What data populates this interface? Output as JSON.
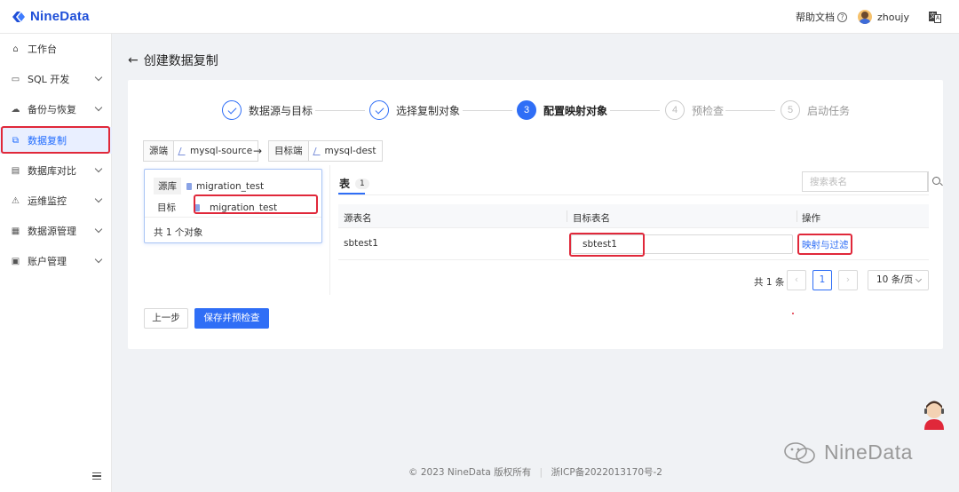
{
  "header": {
    "brand": "NineData",
    "help_label": "帮助文档",
    "user_name": "zhoujy"
  },
  "sidebar": {
    "items": [
      {
        "label": "工作台",
        "icon": "home-icon",
        "has_arrow": false
      },
      {
        "label": "SQL 开发",
        "icon": "monitor-icon",
        "has_arrow": true
      },
      {
        "label": "备份与恢复",
        "icon": "cloud-backup-icon",
        "has_arrow": true
      },
      {
        "label": "数据复制",
        "icon": "replication-icon",
        "has_arrow": false,
        "active": true
      },
      {
        "label": "数据库对比",
        "icon": "compare-icon",
        "has_arrow": true
      },
      {
        "label": "运维监控",
        "icon": "monitor-alarm-icon",
        "has_arrow": true
      },
      {
        "label": "数据源管理",
        "icon": "datasource-icon",
        "has_arrow": true
      },
      {
        "label": "账户管理",
        "icon": "account-icon",
        "has_arrow": true
      }
    ]
  },
  "page": {
    "title": "创建数据复制"
  },
  "steps": [
    {
      "label": "数据源与目标",
      "state": "done",
      "number": "1"
    },
    {
      "label": "选择复制对象",
      "state": "done",
      "number": "2"
    },
    {
      "label": "配置映射对象",
      "state": "current",
      "number": "3"
    },
    {
      "label": "预检查",
      "state": "pending",
      "number": "4"
    },
    {
      "label": "启动任务",
      "state": "pending",
      "number": "5"
    }
  ],
  "endpoints": {
    "source_label": "源端",
    "source_value": "mysql-source",
    "target_label": "目标端",
    "target_value": "mysql-dest"
  },
  "mapping_panel": {
    "source_db_label": "源库",
    "source_db": "migration_test",
    "target_db_label": "目标",
    "target_db": "migration_test",
    "count_text": "共 1 个对象"
  },
  "table_tab": {
    "label": "表",
    "count": "1",
    "search_placeholder": "搜索表名"
  },
  "table": {
    "headers": [
      "源表名",
      "目标表名",
      "操作"
    ],
    "rows": [
      {
        "source": "sbtest1",
        "target": "sbtest1",
        "action": "映射与过滤"
      }
    ]
  },
  "pagination": {
    "total_text": "共 1 条",
    "current_page": "1",
    "page_size": "10 条/页"
  },
  "actions": {
    "prev": "上一步",
    "save": "保存并预检查"
  },
  "footer": {
    "copyright": "© 2023 NineData 版权所有",
    "icp": "浙ICP备2022013170号-2"
  },
  "watermark": "NineData",
  "colors": {
    "accent": "#2f6ef6",
    "brand": "#1f4fd8",
    "highlight": "#e0283a"
  }
}
